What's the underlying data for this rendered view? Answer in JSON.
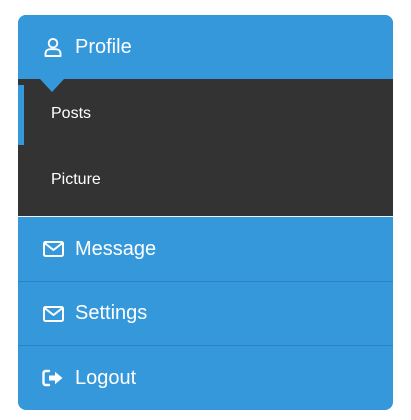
{
  "menu": {
    "accent_color": "#3498db",
    "submenu_color": "#333333",
    "profile": {
      "label": "Profile",
      "icon": "user-icon",
      "expanded": true
    },
    "submenu": {
      "items": [
        {
          "label": "Posts",
          "active": true
        },
        {
          "label": "Picture",
          "active": false
        }
      ]
    },
    "items": [
      {
        "label": "Message",
        "icon": "envelope-icon"
      },
      {
        "label": "Settings",
        "icon": "envelope-icon"
      },
      {
        "label": "Logout",
        "icon": "sign-out-icon"
      }
    ]
  }
}
